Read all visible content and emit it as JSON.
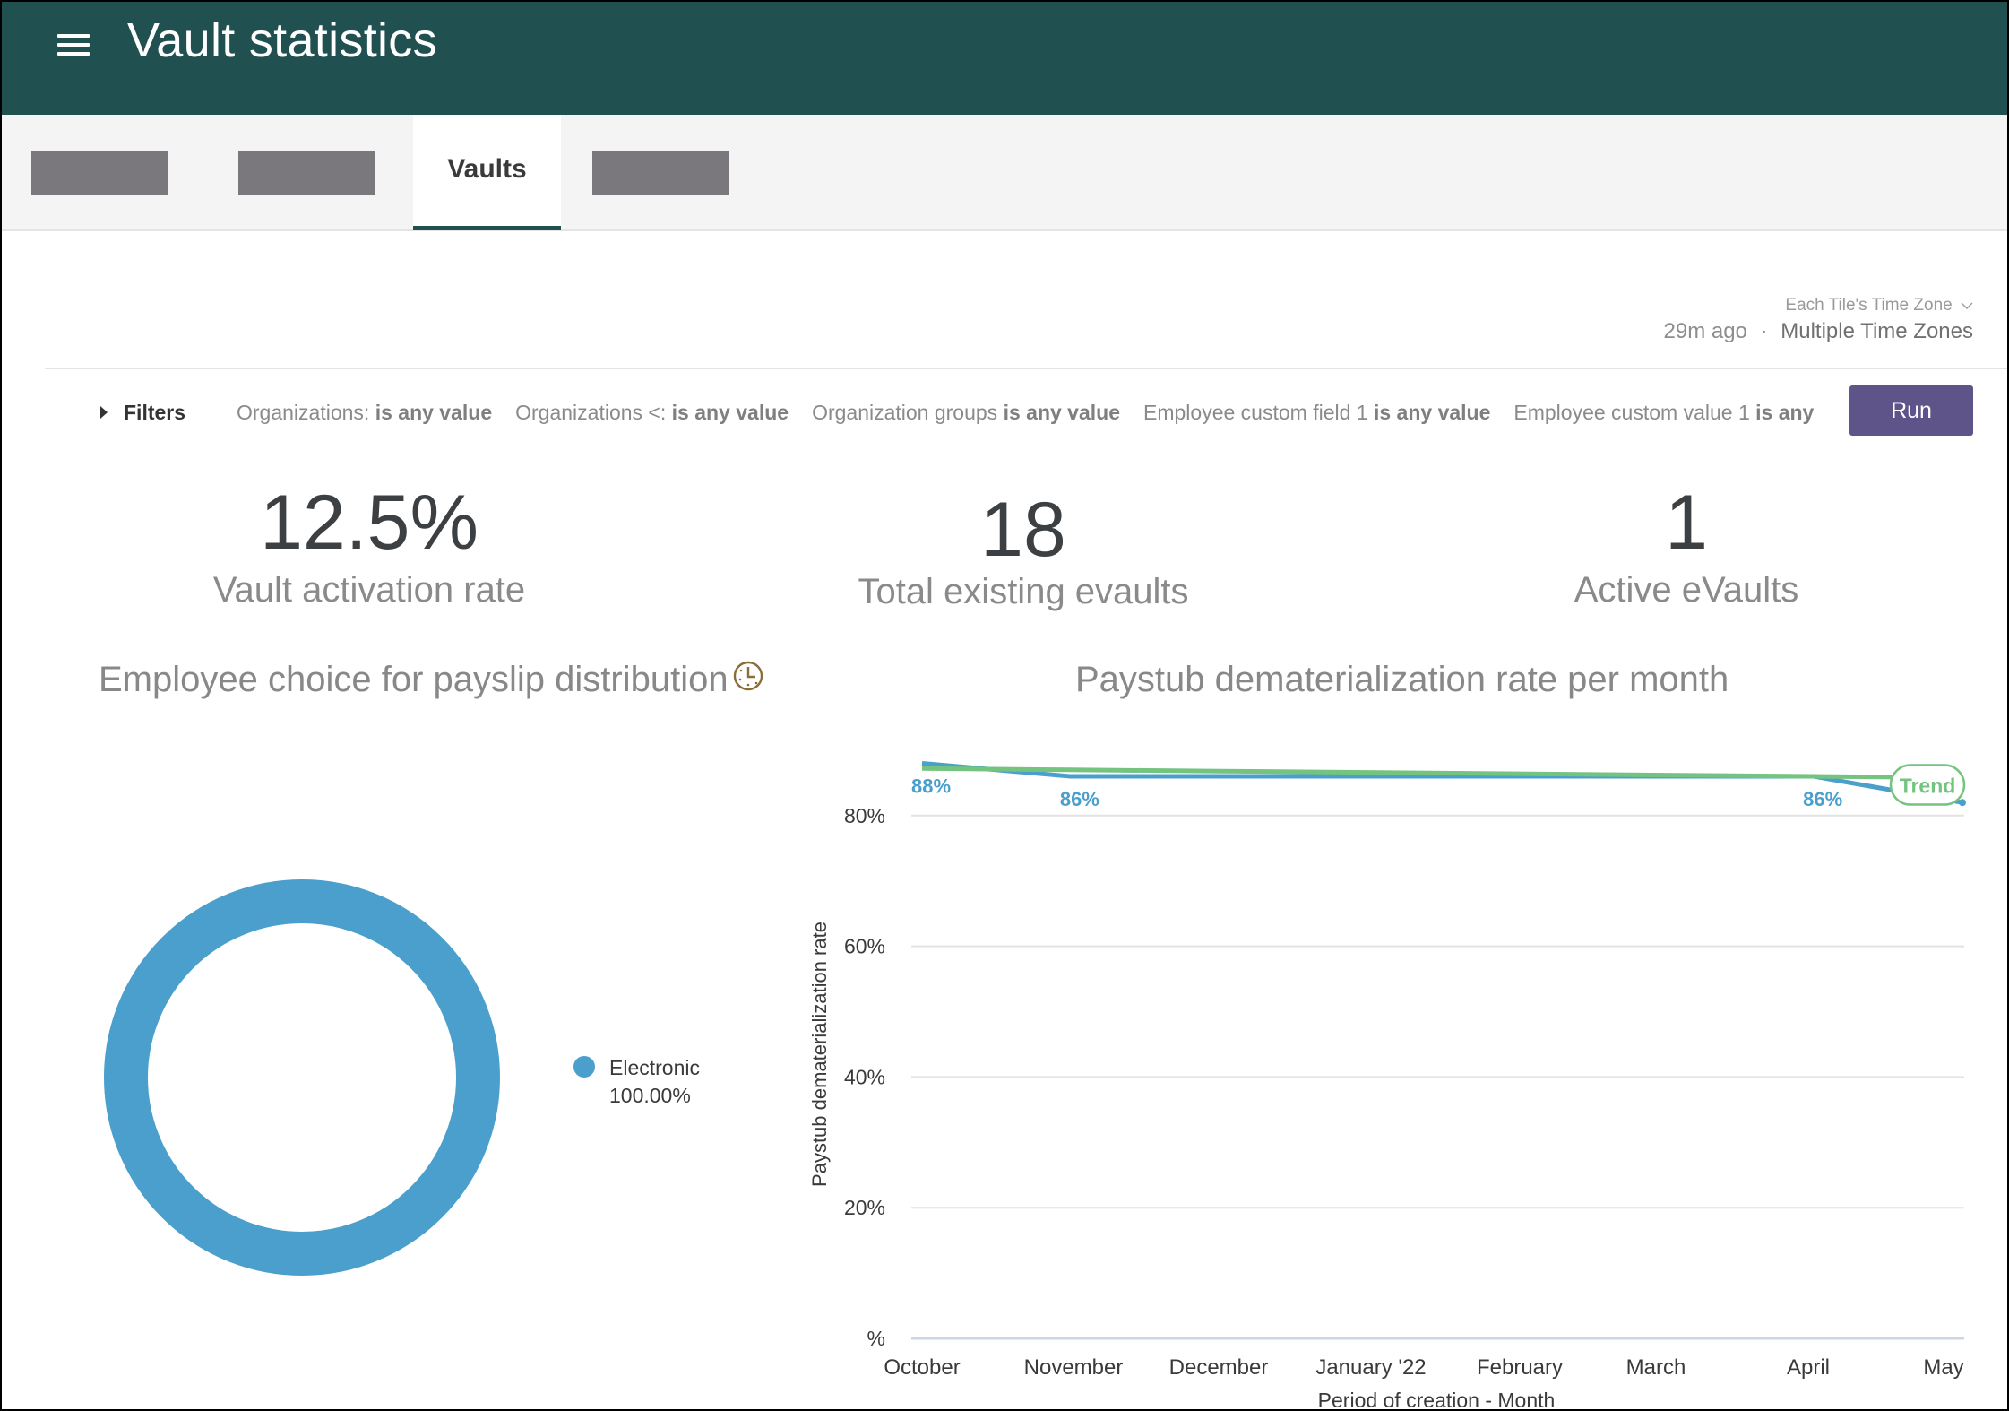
{
  "header": {
    "title": "Vault statistics",
    "menu_icon": "hamburger-menu-icon"
  },
  "tabs": [
    {
      "label": "",
      "redacted": true
    },
    {
      "label": "",
      "redacted": true
    },
    {
      "label": "Vaults",
      "active": true
    },
    {
      "label": "",
      "redacted": true
    }
  ],
  "timezone": {
    "selector_label": "Each Tile's Time Zone",
    "selector_icon": "chevron-down-icon",
    "last_run": "29m ago",
    "separator": "·",
    "zone_value": "Multiple Time Zones"
  },
  "filters": {
    "toggle_label": "Filters",
    "items": [
      {
        "field": "Organizations:",
        "condition": "is any value"
      },
      {
        "field": "Organizations <:",
        "condition": "is any value"
      },
      {
        "field": "Organization groups",
        "condition": "is any value"
      },
      {
        "field": "Employee custom field 1",
        "condition": "is any value"
      },
      {
        "field": "Employee custom value 1",
        "condition": "is any"
      }
    ],
    "run_label": "Run"
  },
  "kpis": [
    {
      "value": "12.5%",
      "label": "Vault activation rate"
    },
    {
      "value": "18",
      "label": "Total existing evaults"
    },
    {
      "value": "1",
      "label": "Active eVaults"
    }
  ],
  "colors": {
    "header_bg": "#20504f",
    "run_button": "#5f5489",
    "series_blue": "#4a9fcc",
    "trend_green": "#74c47f",
    "clock_icon": "#8b6d3a"
  },
  "chart_data": [
    {
      "type": "pie",
      "title": "Employee choice for payslip distribution",
      "title_icon": "clock-icon",
      "donut": true,
      "slices": [
        {
          "label": "Electronic",
          "value": 100.0,
          "display": "100.00%",
          "color": "#4a9fcc"
        }
      ],
      "legend": "right"
    },
    {
      "type": "line",
      "title": "Paystub dematerialization rate per month",
      "xlabel": "Period of creation - Month",
      "ylabel": "Paystub dematerialization rate",
      "categories": [
        "October",
        "November",
        "December",
        "January '22",
        "February",
        "March",
        "April",
        "May"
      ],
      "series": [
        {
          "name": "Paystub dematerialization rate",
          "color": "#4a9fcc",
          "values": [
            88,
            86,
            86,
            86,
            86,
            86,
            86,
            82
          ]
        },
        {
          "name": "Trend",
          "color": "#74c47f",
          "values": [
            87.2,
            87.0,
            86.8,
            86.6,
            86.4,
            86.2,
            86.0,
            85.8
          ]
        }
      ],
      "data_labels": [
        {
          "index": 0,
          "text": "88%"
        },
        {
          "index": 1,
          "text": "86%"
        },
        {
          "index": 6,
          "text": "86%"
        }
      ],
      "trend_label": "Trend",
      "yticks": [
        "%",
        "20%",
        "40%",
        "60%",
        "80%"
      ],
      "ytick_values": [
        0,
        20,
        40,
        60,
        80
      ],
      "ylim": [
        0,
        100
      ],
      "grid": true
    }
  ]
}
